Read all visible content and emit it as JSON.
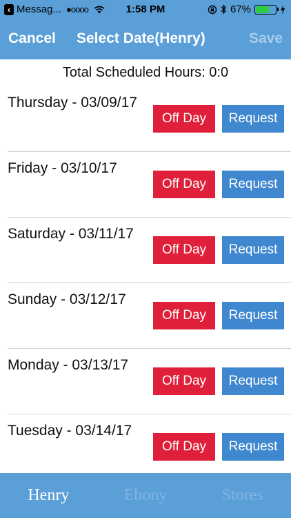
{
  "status_bar": {
    "back_app": "Messag...",
    "signal": "●oooo",
    "time": "1:58 PM",
    "battery_percent": "67%",
    "battery_level": 0.67
  },
  "nav": {
    "cancel_label": "Cancel",
    "title": "Select Date(Henry)",
    "save_label": "Save"
  },
  "total_hours": "Total Scheduled Hours: 0:0",
  "days": [
    {
      "label": "Thursday - 03/09/17",
      "off_label": "Off Day",
      "request_label": "Request"
    },
    {
      "label": "Friday - 03/10/17",
      "off_label": "Off Day",
      "request_label": "Request"
    },
    {
      "label": "Saturday - 03/11/17",
      "off_label": "Off Day",
      "request_label": "Request"
    },
    {
      "label": "Sunday - 03/12/17",
      "off_label": "Off Day",
      "request_label": "Request"
    },
    {
      "label": "Monday - 03/13/17",
      "off_label": "Off Day",
      "request_label": "Request"
    },
    {
      "label": "Tuesday - 03/14/17",
      "off_label": "Off Day",
      "request_label": "Request"
    }
  ],
  "tabs": [
    {
      "label": "Henry",
      "active": true
    },
    {
      "label": "Ebony",
      "active": false
    },
    {
      "label": "Stores",
      "active": false
    }
  ],
  "colors": {
    "bar_blue": "#5b9fd9",
    "off_day_red": "#e0203a",
    "request_blue": "#3f87cf"
  }
}
